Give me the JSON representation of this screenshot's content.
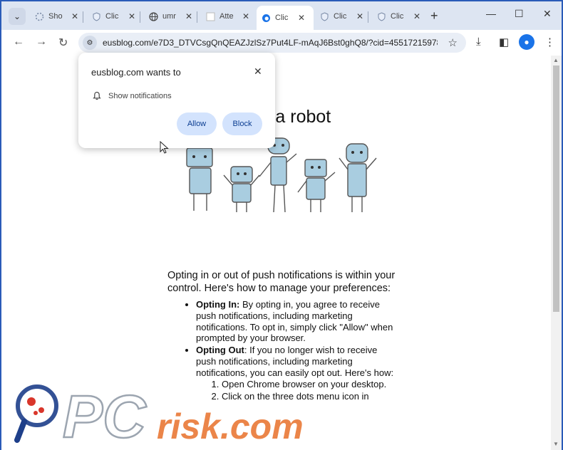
{
  "tabs": [
    {
      "title": "Sho",
      "icon": "loading-icon",
      "active": false
    },
    {
      "title": "Clic",
      "icon": "shield-icon",
      "active": false
    },
    {
      "title": "umr",
      "icon": "globe-icon",
      "active": false
    },
    {
      "title": "Atte",
      "icon": "blank-page-icon",
      "active": false
    },
    {
      "title": "Clic",
      "icon": "edge-icon",
      "active": true
    },
    {
      "title": "Clic",
      "icon": "shield-icon",
      "active": false
    },
    {
      "title": "Clic",
      "icon": "shield-icon",
      "active": false
    }
  ],
  "toolbar": {
    "url": "eusblog.com/e7D3_DTVCsgQnQEAZJzlSz7Put4LF-mAqJ6Bst0ghQ8/?cid=455172159788..."
  },
  "page": {
    "headline": "ou are not   a robot",
    "intro": "Opting in or out of push notifications is within your control. Here's how to manage your preferences:",
    "bullets": [
      {
        "label": "Opting In:",
        "text": " By opting in, you agree to receive push notifications, including marketing notifications. To opt in, simply click \"Allow\" when prompted by your browser."
      },
      {
        "label": "Opting Out",
        "text": ": If you no longer wish to receive push notifications, including marketing notifications, you can easily opt out. Here's how:"
      }
    ],
    "steps": [
      "Open Chrome browser on your desktop.",
      "Click on the three dots menu icon in"
    ]
  },
  "popup": {
    "title": "eusblog.com wants to",
    "permission": "Show notifications",
    "allow": "Allow",
    "block": "Block"
  },
  "watermark": {
    "text_pc": "PC",
    "text_risk": "risk.com"
  },
  "colors": {
    "accent": "#1a73e8",
    "button_bg": "#d3e3fd",
    "button_text": "#0b3d91",
    "robot_body": "#a9cde0",
    "watermark_orange": "#e8702a"
  }
}
